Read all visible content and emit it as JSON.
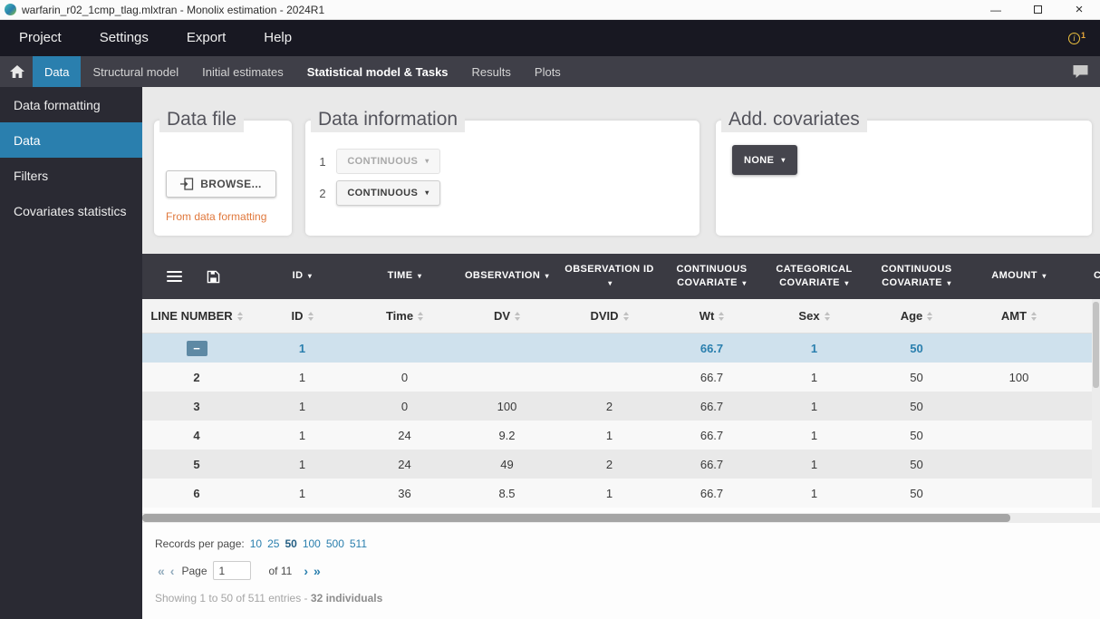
{
  "window": {
    "title": "warfarin_r02_1cmp_tlag.mlxtran - Monolix estimation - 2024R1"
  },
  "menu": {
    "items": [
      "Project",
      "Settings",
      "Export",
      "Help"
    ],
    "notification_count": "1"
  },
  "tabs": {
    "items": [
      {
        "label": "Data",
        "active": true
      },
      {
        "label": "Structural model"
      },
      {
        "label": "Initial estimates"
      },
      {
        "label": "Statistical model & Tasks",
        "bold": true
      },
      {
        "label": "Results"
      },
      {
        "label": "Plots"
      }
    ]
  },
  "sidebar": {
    "items": [
      {
        "label": "Data formatting"
      },
      {
        "label": "Data",
        "active": true
      },
      {
        "label": "Filters"
      },
      {
        "label": "Covariates statistics"
      }
    ]
  },
  "panels": {
    "data_file": {
      "title": "Data file",
      "browse_label": "BROWSE...",
      "link": "From data formatting"
    },
    "data_information": {
      "title": "Data information",
      "rows": [
        {
          "index": "1",
          "value": "CONTINUOUS",
          "disabled": true
        },
        {
          "index": "2",
          "value": "CONTINUOUS"
        }
      ]
    },
    "add_covariates": {
      "title": "Add. covariates",
      "value": "NONE"
    }
  },
  "table": {
    "type_headers": [
      {
        "label": "ID"
      },
      {
        "label": "TIME"
      },
      {
        "label": "OBSERVATION"
      },
      {
        "label": "OBSERVATION ID"
      },
      {
        "label": "CONTINUOUS COVARIATE"
      },
      {
        "label": "CATEGORICAL COVARIATE"
      },
      {
        "label": "CONTINUOUS COVARIATE"
      },
      {
        "label": "AMOUNT"
      },
      {
        "label": "C",
        "cut": true
      }
    ],
    "column_headers": [
      "LINE NUMBER",
      "ID",
      "Time",
      "DV",
      "DVID",
      "Wt",
      "Sex",
      "Age",
      "AMT"
    ],
    "rows": [
      {
        "expander": true,
        "selected": true,
        "cells": [
          "",
          "1",
          "",
          "",
          "",
          "66.7",
          "1",
          "50",
          ""
        ]
      },
      {
        "cells": [
          "2",
          "1",
          "0",
          "",
          "",
          "66.7",
          "1",
          "50",
          "100"
        ]
      },
      {
        "cells": [
          "3",
          "1",
          "0",
          "100",
          "2",
          "66.7",
          "1",
          "50",
          ""
        ]
      },
      {
        "cells": [
          "4",
          "1",
          "24",
          "9.2",
          "1",
          "66.7",
          "1",
          "50",
          ""
        ]
      },
      {
        "cells": [
          "5",
          "1",
          "24",
          "49",
          "2",
          "66.7",
          "1",
          "50",
          ""
        ]
      },
      {
        "cells": [
          "6",
          "1",
          "36",
          "8.5",
          "1",
          "66.7",
          "1",
          "50",
          ""
        ]
      }
    ]
  },
  "footer": {
    "records_label": "Records per page:",
    "records_options": [
      "10",
      "25",
      "50",
      "100",
      "500",
      "511"
    ],
    "records_selected": "50",
    "page_label": "Page",
    "page_value": "1",
    "page_total": "of 11",
    "showing_text": "Showing 1 to 50 of 511 entries - ",
    "individuals_text": "32 individuals"
  },
  "icons": {
    "app_logo": "monolix-logo",
    "notification": "info-circle",
    "home": "home",
    "feedback": "speech-bubble",
    "table_menu": "hamburger-menu",
    "table_save": "floppy-disk",
    "browse": "import-file-icon",
    "sort": "sort-arrows",
    "caret": "▾",
    "expander_collapse": "−",
    "info_letter": "i",
    "pager_first": "«",
    "pager_prev": "‹",
    "pager_next": "›",
    "pager_last": "»",
    "minimize": "—",
    "close": "×"
  },
  "colors": {
    "accent_blue": "#2a7fae",
    "orange_link": "#e0783c",
    "selected_row_bg": "#cfe1ed",
    "dark_header": "#3a3a42"
  }
}
